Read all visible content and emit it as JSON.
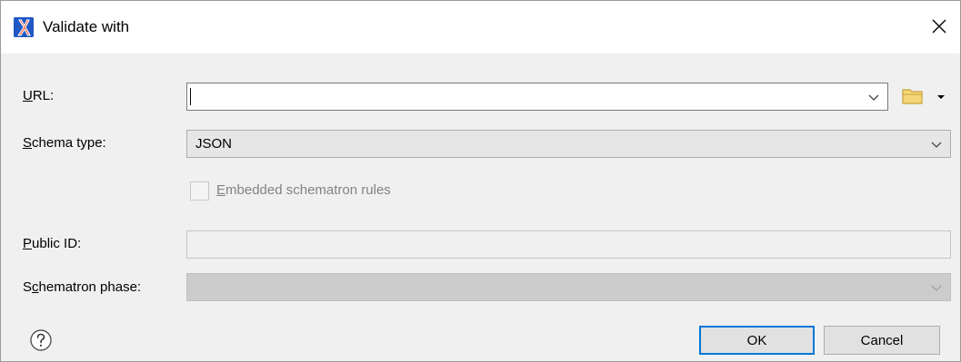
{
  "window": {
    "title": "Validate with",
    "app_icon": "oxygen-x-icon",
    "close_icon": "close-icon"
  },
  "form": {
    "url": {
      "label_underlined": "U",
      "label_rest": "RL:",
      "value": "",
      "dropdown_icon": "chevron-down-icon",
      "browse_icon": "folder-icon"
    },
    "schema_type": {
      "label_underlined": "S",
      "label_rest": "chema type:",
      "selected": "JSON",
      "dropdown_icon": "chevron-down-icon"
    },
    "embedded_rules": {
      "label_underlined": "E",
      "label_rest": "mbedded schematron rules",
      "checked": false,
      "enabled": false
    },
    "public_id": {
      "label_underlined": "P",
      "label_rest": "ublic ID:",
      "value": ""
    },
    "schematron_phase": {
      "label_prefix": "S",
      "label_underlined": "c",
      "label_rest": "hematron phase:",
      "selected": ""
    }
  },
  "footer": {
    "help_icon": "help-icon",
    "ok_label": "OK",
    "cancel_label": "Cancel"
  },
  "colors": {
    "accent": "#0078d7",
    "app_icon_bg": "#1f57c4",
    "app_icon_fg": "#e8402a",
    "folder": "#e8c25a"
  }
}
